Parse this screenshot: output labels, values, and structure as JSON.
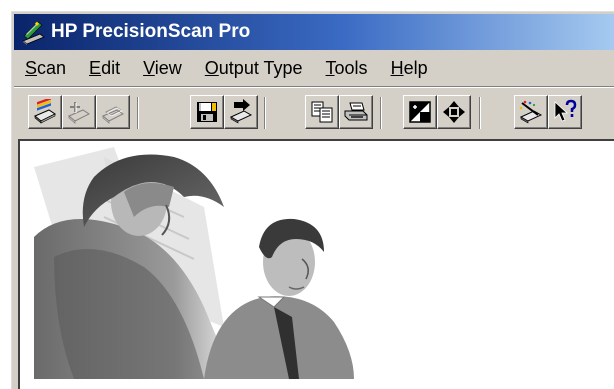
{
  "window": {
    "title": "HP PrecisionScan Pro",
    "app_icon": "scanner-icon"
  },
  "menu": [
    {
      "label": "Scan",
      "accel": "S",
      "rest": "can"
    },
    {
      "label": "Edit",
      "accel": "E",
      "rest": "dit"
    },
    {
      "label": "View",
      "accel": "V",
      "rest": "iew"
    },
    {
      "label": "Output Type",
      "accel": "O",
      "rest": "utput Type"
    },
    {
      "label": "Tools",
      "accel": "T",
      "rest": "ools"
    },
    {
      "label": "Help",
      "accel": "H",
      "rest": "elp"
    }
  ],
  "toolbar": {
    "buttons": [
      {
        "name": "new-scan-icon",
        "enabled": true
      },
      {
        "name": "add-scan-icon",
        "enabled": false
      },
      {
        "name": "rescan-icon",
        "enabled": false
      },
      {
        "name": "save-icon",
        "enabled": true
      },
      {
        "name": "send-to-icon",
        "enabled": true
      },
      {
        "name": "copy-icon",
        "enabled": true
      },
      {
        "name": "print-icon",
        "enabled": true
      },
      {
        "name": "exposure-icon",
        "enabled": true
      },
      {
        "name": "resize-icon",
        "enabled": true
      },
      {
        "name": "clear-area-icon",
        "enabled": true
      },
      {
        "name": "help-pointer-icon",
        "enabled": true
      }
    ]
  },
  "preview": {
    "image": "scanned-sketch-two-people"
  }
}
